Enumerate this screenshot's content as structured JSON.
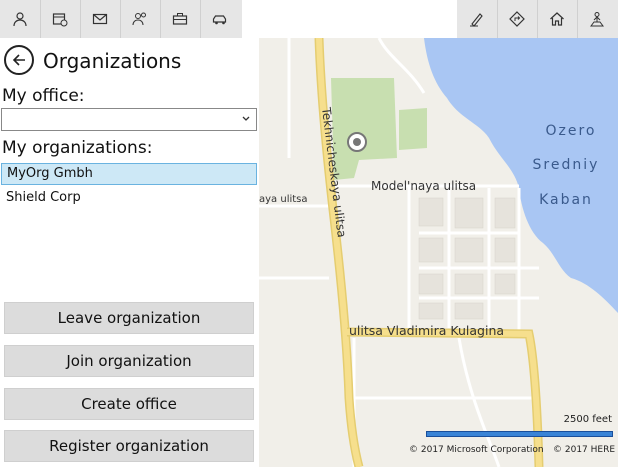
{
  "toolbar": {
    "left_icons": [
      "person-icon",
      "calendar-icon",
      "mail-icon",
      "people-icon",
      "briefcase-icon",
      "car-icon"
    ],
    "right_icons": [
      "pen-icon",
      "directions-icon",
      "home-icon",
      "location-person-icon"
    ]
  },
  "page": {
    "title": "Organizations",
    "office_label": "My office:",
    "office_value": "",
    "organizations_label": "My organizations:"
  },
  "organizations": [
    {
      "name": "MyOrg Gmbh",
      "selected": true
    },
    {
      "name": "Shield Corp",
      "selected": false
    }
  ],
  "actions": {
    "leave": "Leave organization",
    "join": "Join organization",
    "create_office": "Create office",
    "register": "Register organization"
  },
  "map": {
    "labels": {
      "lake": "Ozero Srredniy Kaban",
      "lake_line1": "Ozero",
      "lake_line2": "Sredniy",
      "lake_line3": "Kaban",
      "street1": "Tekhnicheskaya ulitsa",
      "street2": "Model'naya ulitsa",
      "street3": "ulitsa Vladimira Kulagina",
      "street4": "aya ulitsa"
    },
    "scale": "2500 feet",
    "copyright_ms": "© 2017 Microsoft Corporation",
    "copyright_here": "© 2017 HERE",
    "colors": {
      "water": "#a9c6f3",
      "park": "#c8dfb0",
      "road_major": "#f6df8d",
      "background": "#f1efe9"
    }
  }
}
